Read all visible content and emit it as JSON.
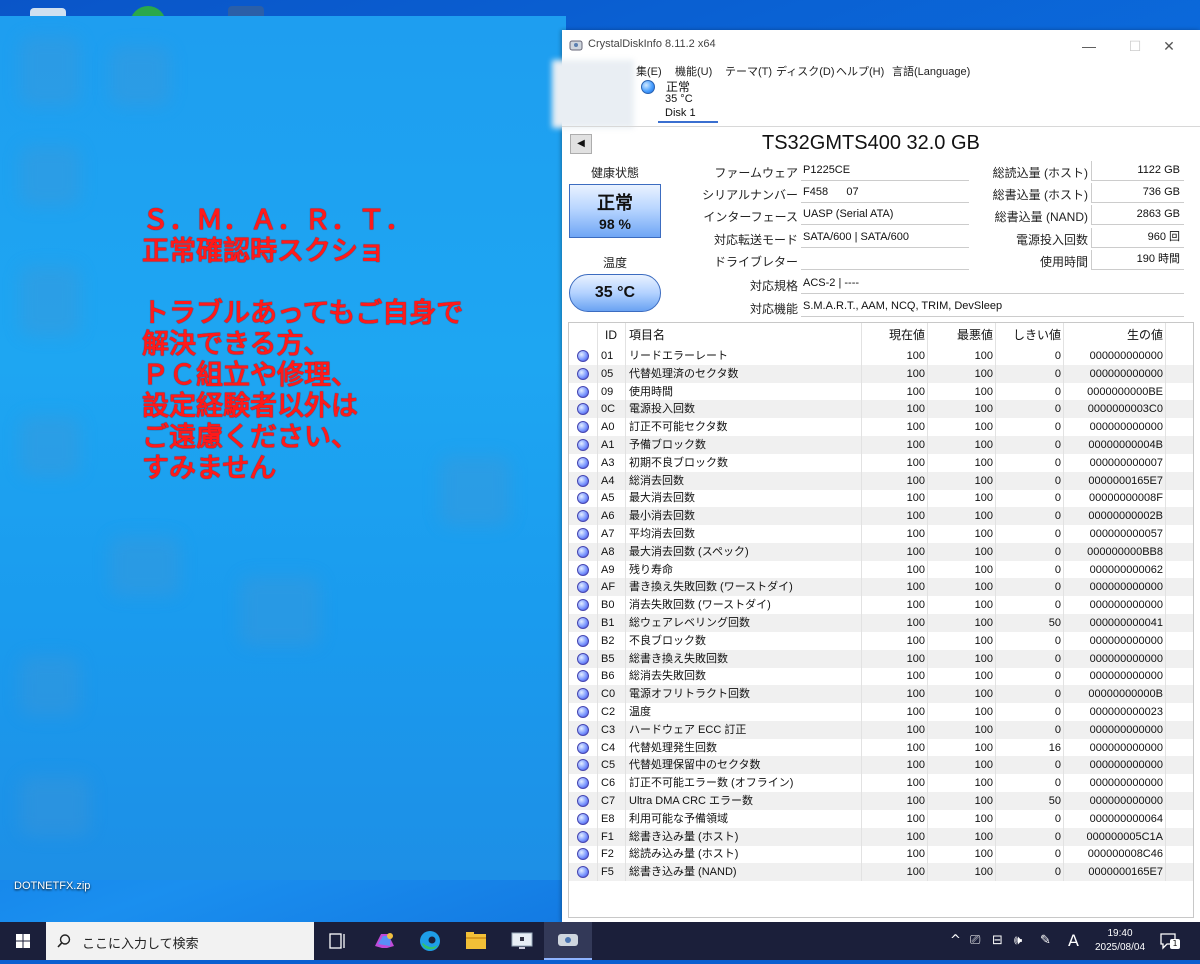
{
  "desktop": {
    "overlay_text": "Ｓ．Ｍ．Ａ．Ｒ．Ｔ．\n正常確認時スクショ\n\nトラブルあってもご自身で\n解決できる方、\nＰＣ組立や修理、\n設定経験者以外は\nご遠慮ください、\nすみません",
    "file_label": "DOTNETFX.zip"
  },
  "window": {
    "title": "CrystalDiskInfo 8.11.2 x64",
    "menu": [
      "集(E)",
      "機能(U)",
      "テーマ(T)",
      "ディスク(D)",
      "ヘルプ(H)",
      "言語(Language)"
    ],
    "disk_tab": {
      "status": "正常",
      "temp": "35 °C",
      "name": "Disk 1"
    },
    "model": "TS32GMTS400 32.0 GB",
    "health_label": "健康状態",
    "health_status": "正常",
    "health_pct": "98 %",
    "temp_label": "温度",
    "temp_value": "35 °C",
    "info": {
      "firmware_label": "ファームウェア",
      "firmware": "P1225CE",
      "serial_label": "シリアルナンバー",
      "serial": "F458      07",
      "interface_label": "インターフェース",
      "interface": "UASP (Serial ATA)",
      "transfer_label": "対応転送モード",
      "transfer": "SATA/600 | SATA/600",
      "drive_letter_label": "ドライブレター",
      "drive_letter": "",
      "standard_label": "対応規格",
      "standard": "ACS-2 | ----",
      "features_label": "対応機能",
      "features": "S.M.A.R.T., AAM, NCQ, TRIM, DevSleep",
      "host_reads_label": "総読込量 (ホスト)",
      "host_reads": "1122 GB",
      "host_writes_label": "総書込量 (ホスト)",
      "host_writes": "736 GB",
      "nand_writes_label": "総書込量 (NAND)",
      "nand_writes": "2863 GB",
      "power_on_count_label": "電源投入回数",
      "power_on_count": "960 回",
      "power_on_hours_label": "使用時間",
      "power_on_hours": "190 時間"
    },
    "table": {
      "headers": [
        "ID",
        "項目名",
        "現在値",
        "最悪値",
        "しきい値",
        "生の値"
      ],
      "rows": [
        [
          "01",
          "リードエラーレート",
          "100",
          "100",
          "0",
          "000000000000"
        ],
        [
          "05",
          "代替処理済のセクタ数",
          "100",
          "100",
          "0",
          "000000000000"
        ],
        [
          "09",
          "使用時間",
          "100",
          "100",
          "0",
          "0000000000BE"
        ],
        [
          "0C",
          "電源投入回数",
          "100",
          "100",
          "0",
          "0000000003C0"
        ],
        [
          "A0",
          "訂正不可能セクタ数",
          "100",
          "100",
          "0",
          "000000000000"
        ],
        [
          "A1",
          "予備ブロック数",
          "100",
          "100",
          "0",
          "00000000004B"
        ],
        [
          "A3",
          "初期不良ブロック数",
          "100",
          "100",
          "0",
          "000000000007"
        ],
        [
          "A4",
          "総消去回数",
          "100",
          "100",
          "0",
          "0000000165E7"
        ],
        [
          "A5",
          "最大消去回数",
          "100",
          "100",
          "0",
          "00000000008F"
        ],
        [
          "A6",
          "最小消去回数",
          "100",
          "100",
          "0",
          "00000000002B"
        ],
        [
          "A7",
          "平均消去回数",
          "100",
          "100",
          "0",
          "000000000057"
        ],
        [
          "A8",
          "最大消去回数 (スペック)",
          "100",
          "100",
          "0",
          "000000000BB8"
        ],
        [
          "A9",
          "残り寿命",
          "100",
          "100",
          "0",
          "000000000062"
        ],
        [
          "AF",
          "書き換え失敗回数 (ワーストダイ)",
          "100",
          "100",
          "0",
          "000000000000"
        ],
        [
          "B0",
          "消去失敗回数 (ワーストダイ)",
          "100",
          "100",
          "0",
          "000000000000"
        ],
        [
          "B1",
          "総ウェアレベリング回数",
          "100",
          "100",
          "50",
          "000000000041"
        ],
        [
          "B2",
          "不良ブロック数",
          "100",
          "100",
          "0",
          "000000000000"
        ],
        [
          "B5",
          "総書き換え失敗回数",
          "100",
          "100",
          "0",
          "000000000000"
        ],
        [
          "B6",
          "総消去失敗回数",
          "100",
          "100",
          "0",
          "000000000000"
        ],
        [
          "C0",
          "電源オフリトラクト回数",
          "100",
          "100",
          "0",
          "00000000000B"
        ],
        [
          "C2",
          "温度",
          "100",
          "100",
          "0",
          "000000000023"
        ],
        [
          "C3",
          "ハードウェア ECC 訂正",
          "100",
          "100",
          "0",
          "000000000000"
        ],
        [
          "C4",
          "代替処理発生回数",
          "100",
          "100",
          "16",
          "000000000000"
        ],
        [
          "C5",
          "代替処理保留中のセクタ数",
          "100",
          "100",
          "0",
          "000000000000"
        ],
        [
          "C6",
          "訂正不可能エラー数 (オフライン)",
          "100",
          "100",
          "0",
          "000000000000"
        ],
        [
          "C7",
          "Ultra DMA CRC エラー数",
          "100",
          "100",
          "50",
          "000000000000"
        ],
        [
          "E8",
          "利用可能な予備領域",
          "100",
          "100",
          "0",
          "000000000064"
        ],
        [
          "F1",
          "総書き込み量 (ホスト)",
          "100",
          "100",
          "0",
          "000000005C1A"
        ],
        [
          "F2",
          "総読み込み量 (ホスト)",
          "100",
          "100",
          "0",
          "000000008C46"
        ],
        [
          "F5",
          "総書き込み量 (NAND)",
          "100",
          "100",
          "0",
          "0000000165E7"
        ]
      ]
    }
  },
  "taskbar": {
    "search_placeholder": "ここに入力して検索",
    "time": "19:40",
    "date": "2025/08/04",
    "ime": "A",
    "notification_count": "1"
  }
}
